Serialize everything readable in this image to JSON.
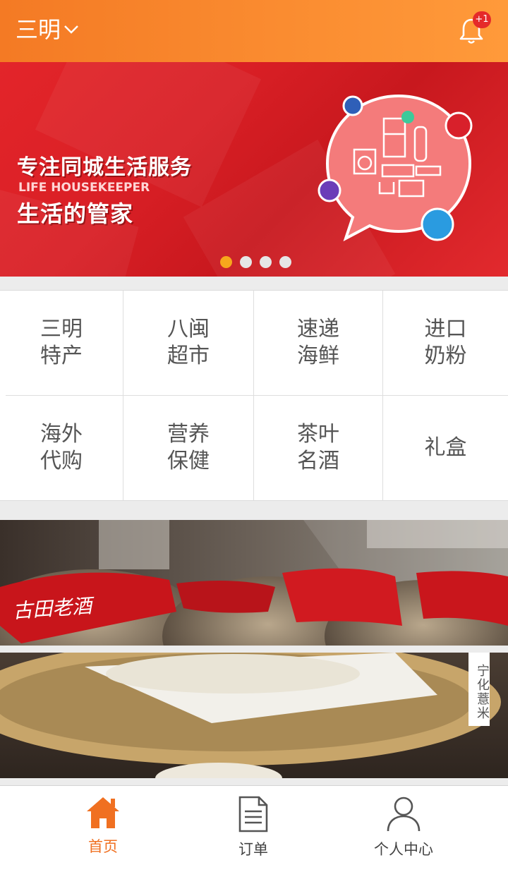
{
  "header": {
    "city": "三明",
    "notification_badge": "+1"
  },
  "banner": {
    "headline": "专注同城生活服务",
    "english": "LIFE HOUSEKEEPER",
    "tagline": "生活的管家",
    "active_slide": 1,
    "slide_count": 4
  },
  "categories": [
    {
      "line1": "三明",
      "line2": "特产"
    },
    {
      "line1": "八闽",
      "line2": "超市"
    },
    {
      "line1": "速递",
      "line2": "海鲜"
    },
    {
      "line1": "进口",
      "line2": "奶粉"
    },
    {
      "line1": "海外",
      "line2": "代购"
    },
    {
      "line1": "营养",
      "line2": "保健"
    },
    {
      "line1": "茶叶",
      "line2": "名酒"
    },
    {
      "line1": "礼盒",
      "line2": ""
    }
  ],
  "promos": [
    {
      "logo_text": "古田老酒"
    },
    {
      "label": "宁化薏米"
    }
  ],
  "tabbar": {
    "items": [
      {
        "label": "首页",
        "icon": "home-icon",
        "active": true
      },
      {
        "label": "订单",
        "icon": "document-icon",
        "active": false
      },
      {
        "label": "个人中心",
        "icon": "user-icon",
        "active": false
      }
    ]
  },
  "colors": {
    "accent": "#f47a24",
    "banner_red": "#e3252a",
    "dot_active": "#f7a61c"
  }
}
